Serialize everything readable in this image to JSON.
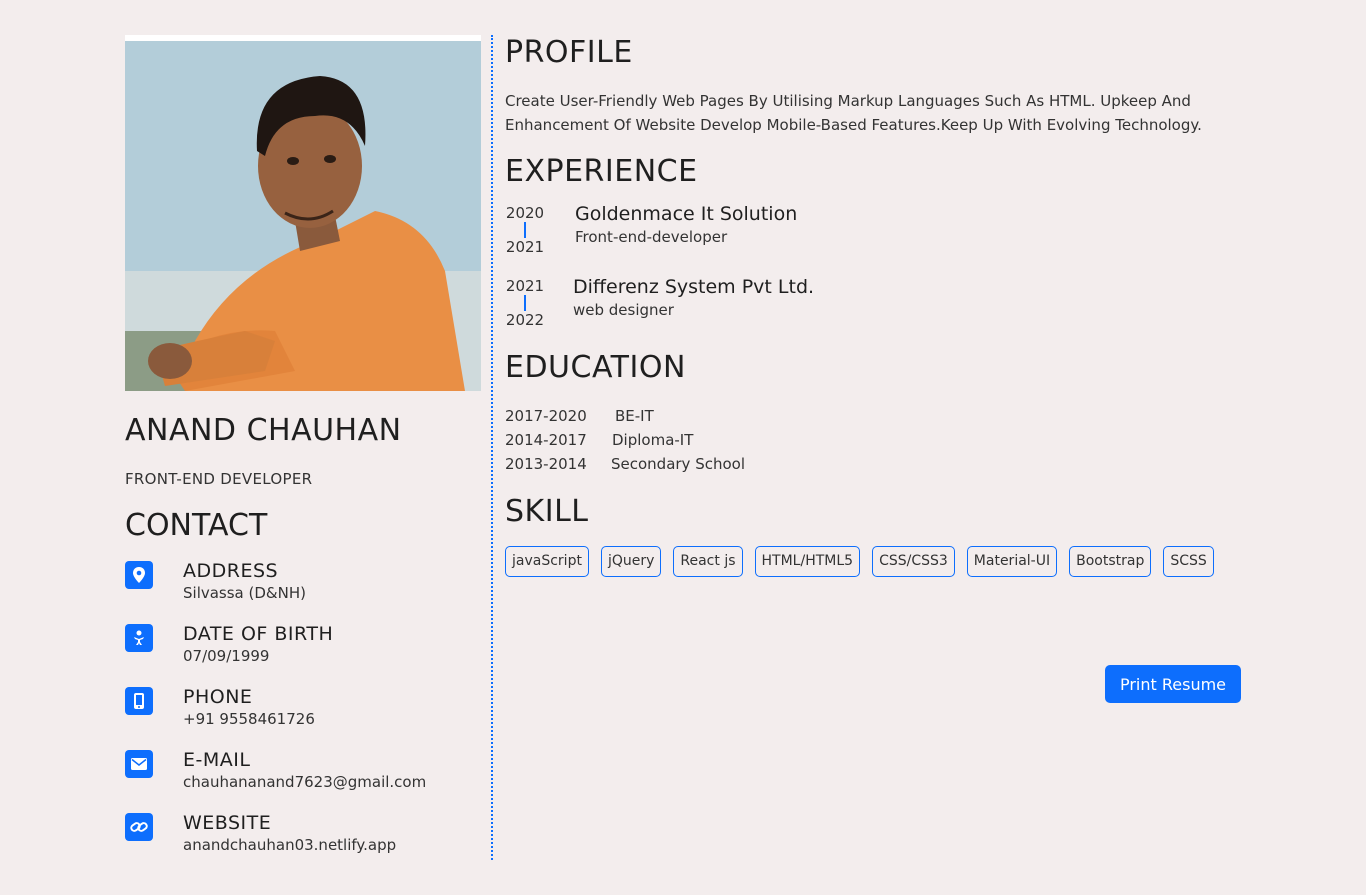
{
  "person": {
    "name": "ANAND CHAUHAN",
    "role": "FRONT-END DEVELOPER"
  },
  "contact": {
    "title": "CONTACT",
    "items": [
      {
        "label": "ADDRESS",
        "value": "Silvassa (D&NH)",
        "icon": "map-pin-icon"
      },
      {
        "label": "DATE OF BIRTH",
        "value": "07/09/1999",
        "icon": "baby-icon"
      },
      {
        "label": "PHONE",
        "value": "+91 9558461726",
        "icon": "mobile-icon"
      },
      {
        "label": "E-MAIL",
        "value": "chauhananand7623@gmail.com",
        "icon": "envelope-icon"
      },
      {
        "label": "WEBSITE",
        "value": "anandchauhan03.netlify.app",
        "icon": "link-icon"
      }
    ]
  },
  "profile": {
    "title": "PROFILE",
    "text": "Create User-Friendly Web Pages By Utilising Markup Languages Such As HTML. Upkeep And Enhancement Of Website Develop Mobile-Based Features.Keep Up With Evolving Technology."
  },
  "experience": {
    "title": "EXPERIENCE",
    "items": [
      {
        "from": "2020",
        "to": "2021",
        "company": "Goldenmace It Solution",
        "position": "Front-end-developer"
      },
      {
        "from": "2021",
        "to": "2022",
        "company": "Differenz System Pvt Ltd.",
        "position": "web designer"
      }
    ]
  },
  "education": {
    "title": "EDUCATION",
    "items": [
      {
        "years": "2017-2020",
        "degree": "BE-IT"
      },
      {
        "years": "2014-2017",
        "degree": "Diploma-IT"
      },
      {
        "years": "2013-2014",
        "degree": "Secondary School"
      }
    ]
  },
  "skill": {
    "title": "SKILL",
    "items": [
      "javaScript",
      "jQuery",
      "React js",
      "HTML/HTML5",
      "CSS/CSS3",
      "Material-UI",
      "Bootstrap",
      "SCSS"
    ]
  },
  "actions": {
    "print_label": "Print Resume"
  },
  "colors": {
    "accent": "#0d6efd",
    "background": "#f3eded"
  }
}
